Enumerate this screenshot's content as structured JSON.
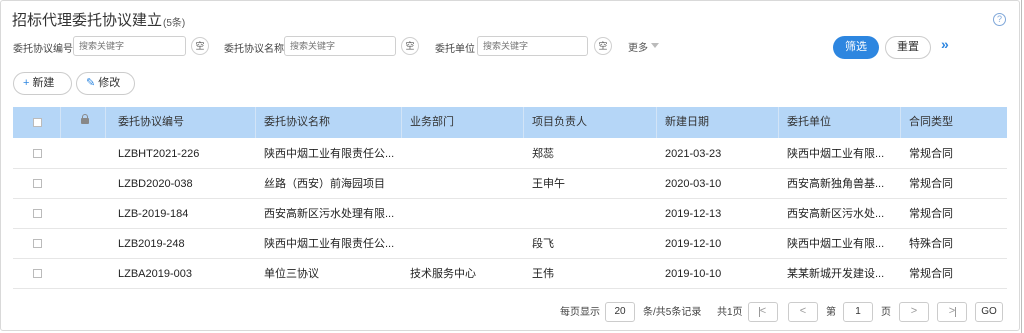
{
  "header": {
    "title": "招标代理委托协议建立",
    "count": "(5条)",
    "help_icon": "?"
  },
  "filters": [
    {
      "label": "委托协议编号",
      "placeholder": "搜索关键字",
      "clear": "空"
    },
    {
      "label": "委托协议名称",
      "placeholder": "搜索关键字",
      "clear": "空"
    },
    {
      "label": "委托单位",
      "placeholder": "搜索关键字",
      "clear": "空"
    }
  ],
  "more_label": "更多",
  "actions": {
    "filter": "筛选",
    "reset": "重置",
    "expand": "»"
  },
  "toolbar": {
    "new_label": "新建",
    "edit_label": "修改",
    "new_icon": "+",
    "edit_icon": "✎"
  },
  "table": {
    "columns": [
      "委托协议编号",
      "委托协议名称",
      "业务部门",
      "项目负责人",
      "新建日期",
      "委托单位",
      "合同类型"
    ],
    "rows": [
      [
        "LZBHT2021-226",
        "陕西中烟工业有限责任公...",
        "",
        "郑蕊",
        "2021-03-23",
        "陕西中烟工业有限...",
        "常规合同"
      ],
      [
        "LZBD2020-038",
        "丝路（西安）前海园项目",
        "",
        "王申午",
        "2020-03-10",
        "西安高新独角兽基...",
        "常规合同"
      ],
      [
        "LZB-2019-184",
        "西安高新区污水处理有限...",
        "",
        "",
        "2019-12-13",
        "西安高新区污水处...",
        "常规合同"
      ],
      [
        "LZB2019-248",
        "陕西中烟工业有限责任公...",
        "",
        "段飞",
        "2019-12-10",
        "陕西中烟工业有限...",
        "特殊合同"
      ],
      [
        "LZBA2019-003",
        "单位三协议",
        "技术服务中心",
        "王伟",
        "2019-10-10",
        "某某新城开发建设...",
        "常规合同"
      ]
    ]
  },
  "pagination": {
    "per_page_label": "每页显示",
    "per_page": "20",
    "total_label": "条/共5条记录",
    "pages_label": "共1页",
    "page_prefix": "第",
    "page": "1",
    "page_suffix": "页",
    "prev": "<",
    "next": ">",
    "go": "GO"
  },
  "colors": {
    "accent": "#2d86e0",
    "header_bg": "#b5d6f7"
  }
}
